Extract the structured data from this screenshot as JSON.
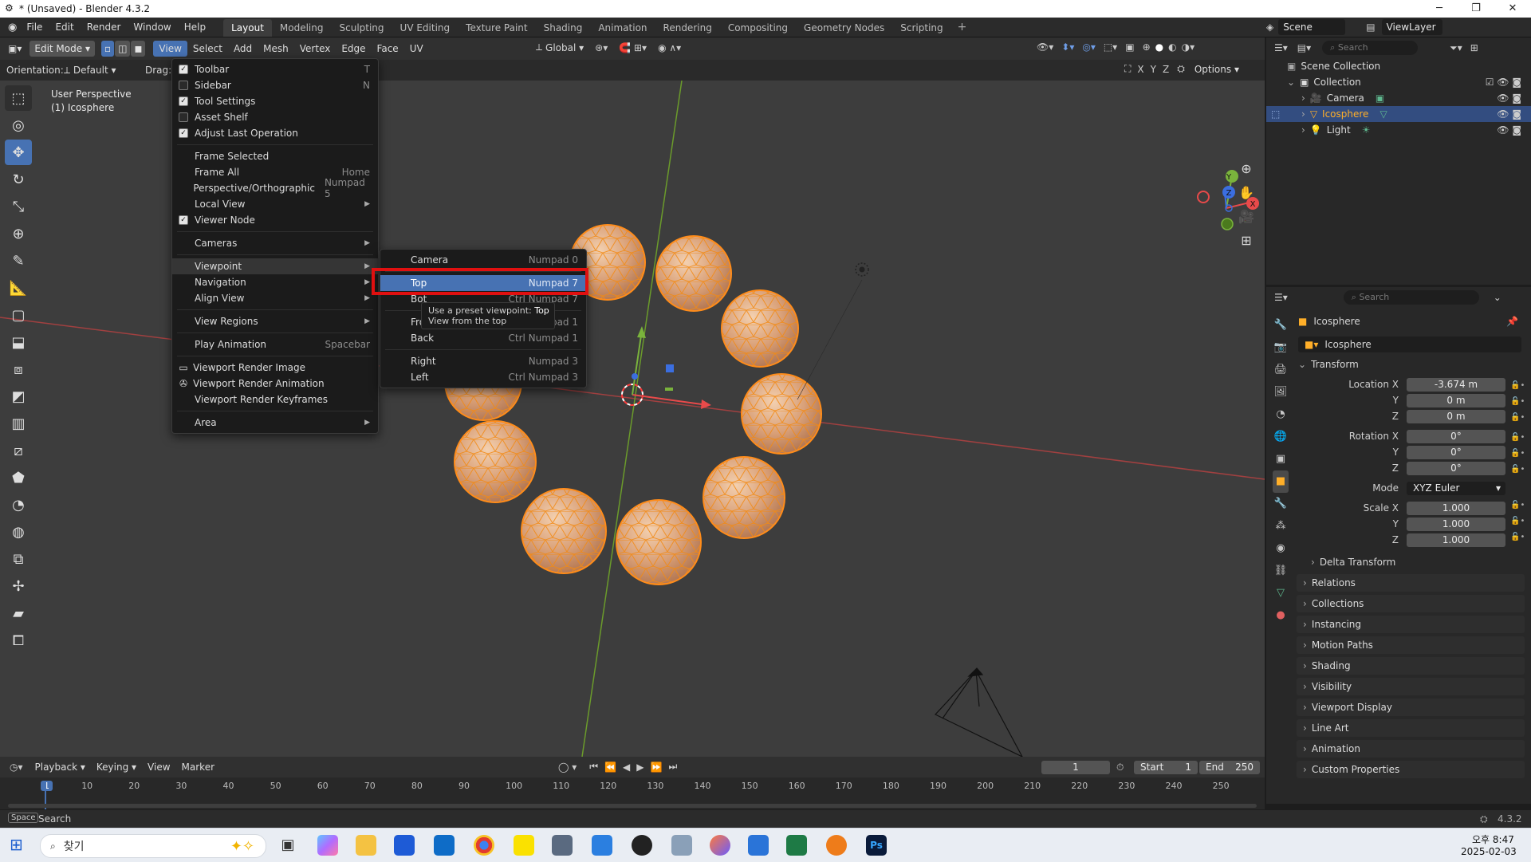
{
  "window": {
    "title": "* (Unsaved) - Blender 4.3.2"
  },
  "top_menu": {
    "items": [
      "File",
      "Edit",
      "Render",
      "Window",
      "Help"
    ],
    "workspaces": [
      "Layout",
      "Modeling",
      "Sculpting",
      "UV Editing",
      "Texture Paint",
      "Shading",
      "Animation",
      "Rendering",
      "Compositing",
      "Geometry Nodes",
      "Scripting"
    ],
    "active_workspace": "Layout",
    "scene": "Scene",
    "view_layer": "ViewLayer"
  },
  "viewport_header": {
    "mode": "Edit Mode",
    "menus": [
      "View",
      "Select",
      "Add",
      "Mesh",
      "Vertex",
      "Edge",
      "Face",
      "UV"
    ],
    "transform_orientation": "Global",
    "orientation_label": "Orientation:",
    "orientation_value": "Default",
    "drag_label": "Drag:",
    "options_label": "Options",
    "axes": [
      "X",
      "Y",
      "Z"
    ]
  },
  "viewport": {
    "perspective_label": "User Perspective",
    "object_label": "(1) Icosphere",
    "gizmo": {
      "x": "X",
      "y": "Y",
      "z": "Z"
    }
  },
  "view_menu": {
    "items": [
      {
        "label": "Toolbar",
        "checked": true,
        "shortcut": "T"
      },
      {
        "label": "Sidebar",
        "checked": false,
        "shortcut": "N"
      },
      {
        "label": "Tool Settings",
        "checked": true,
        "shortcut": ""
      },
      {
        "label": "Asset Shelf",
        "checked": false,
        "shortcut": ""
      },
      {
        "label": "Adjust Last Operation",
        "checked": true,
        "shortcut": ""
      }
    ],
    "items2": [
      {
        "label": "Frame Selected",
        "shortcut": ""
      },
      {
        "label": "Frame All",
        "shortcut": "Home"
      },
      {
        "label": "Perspective/Orthographic",
        "shortcut": "Numpad 5"
      },
      {
        "label": "Local View",
        "shortcut": ""
      }
    ],
    "viewer_node": "Viewer Node",
    "cameras": "Cameras",
    "viewpoint": "Viewpoint",
    "navigation": "Navigation",
    "align_view": "Align View",
    "view_regions": "View Regions",
    "play_animation": "Play Animation",
    "play_shortcut": "Spacebar",
    "render_image": "Viewport Render Image",
    "render_animation": "Viewport Render Animation",
    "render_keyframes": "Viewport Render Keyframes",
    "area": "Area"
  },
  "viewpoint_menu": {
    "camera": {
      "label": "Camera",
      "shortcut": "Numpad 0"
    },
    "top": {
      "label": "Top",
      "shortcut": "Numpad 7"
    },
    "bottom_partial": {
      "label": "Bot",
      "shortcut": "Ctrl Numpad 7"
    },
    "front_partial": {
      "label": "Fro",
      "shortcut": "Numpad 1"
    },
    "back": {
      "label": "Back",
      "shortcut": "Ctrl Numpad 1"
    },
    "right": {
      "label": "Right",
      "shortcut": "Numpad 3"
    },
    "left": {
      "label": "Left",
      "shortcut": "Ctrl Numpad 3"
    }
  },
  "tooltip": {
    "line1_prefix": "Use a preset viewpoint:",
    "line1_value": "Top",
    "line2": "View from the top"
  },
  "outliner": {
    "search_placeholder": "Search",
    "scene_collection": "Scene Collection",
    "collection": "Collection",
    "objects": [
      "Camera",
      "Icosphere",
      "Light"
    ],
    "selected": "Icosphere"
  },
  "properties": {
    "search_placeholder": "Search",
    "object_name": "Icosphere",
    "data_name": "Icosphere",
    "transform_title": "Transform",
    "location_label": "Location X",
    "location": [
      "-3.674 m",
      "0 m",
      "0 m"
    ],
    "rotation_label": "Rotation X",
    "rotation": [
      "0°",
      "0°",
      "0°"
    ],
    "mode_label": "Mode",
    "mode_value": "XYZ Euler",
    "scale_label": "Scale X",
    "scale": [
      "1.000",
      "1.000",
      "1.000"
    ],
    "axis_y": "Y",
    "axis_z": "Z",
    "delta_transform": "Delta Transform",
    "panels": [
      "Relations",
      "Collections",
      "Instancing",
      "Motion Paths",
      "Shading",
      "Visibility",
      "Viewport Display",
      "Line Art",
      "Animation",
      "Custom Properties"
    ]
  },
  "timeline": {
    "menus": [
      "Playback",
      "Keying",
      "View",
      "Marker"
    ],
    "current_frame": "1",
    "start_label": "Start",
    "start": "1",
    "end_label": "End",
    "end": "250",
    "ticks": [
      "1",
      "10",
      "20",
      "30",
      "40",
      "50",
      "60",
      "70",
      "80",
      "90",
      "100",
      "110",
      "120",
      "130",
      "140",
      "150",
      "160",
      "170",
      "180",
      "190",
      "200",
      "210",
      "220",
      "230",
      "240",
      "250"
    ]
  },
  "statusbar": {
    "key": "Space",
    "action": "Search",
    "version": "4.3.2"
  },
  "taskbar": {
    "search_label": "찾기",
    "time": "오후 8:47",
    "date": "2025-02-03"
  },
  "colors": {
    "accent": "#4772b3",
    "selected_orange": "#ffa033",
    "highlight_red": "#e01010"
  }
}
